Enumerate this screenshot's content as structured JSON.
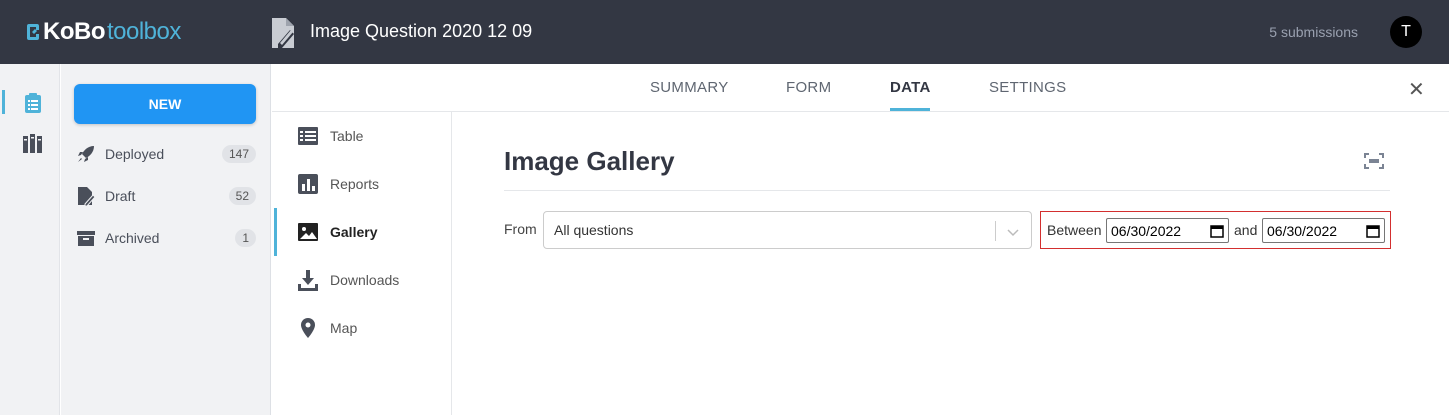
{
  "header": {
    "logo_kobo": "KoBo",
    "logo_toolbox": "toolbox",
    "form_title": "Image Question 2020 12 09",
    "submissions": "5 submissions",
    "avatar_initial": "T"
  },
  "sidebar": {
    "new_label": "NEW",
    "items": [
      {
        "label": "Deployed",
        "count": "147",
        "icon": "rocket-icon"
      },
      {
        "label": "Draft",
        "count": "52",
        "icon": "draft-icon"
      },
      {
        "label": "Archived",
        "count": "1",
        "icon": "archive-icon"
      }
    ]
  },
  "tabs": [
    {
      "label": "SUMMARY"
    },
    {
      "label": "FORM"
    },
    {
      "label": "DATA",
      "active": true
    },
    {
      "label": "SETTINGS"
    }
  ],
  "close_label": "✕",
  "subnav": [
    {
      "label": "Table",
      "icon": "table-icon"
    },
    {
      "label": "Reports",
      "icon": "reports-icon"
    },
    {
      "label": "Gallery",
      "icon": "gallery-icon",
      "active": true
    },
    {
      "label": "Downloads",
      "icon": "download-icon"
    },
    {
      "label": "Map",
      "icon": "map-pin-icon"
    }
  ],
  "main": {
    "title": "Image Gallery",
    "from_label": "From",
    "question_select": "All questions",
    "between_label": "Between",
    "and_label": "and",
    "date_start": "06/30/2022",
    "date_end": "06/30/2022"
  },
  "colors": {
    "header_bg": "#333743",
    "accent": "#4fb3d9",
    "new_button": "#2095f3",
    "highlight_border": "#d32f2f"
  }
}
